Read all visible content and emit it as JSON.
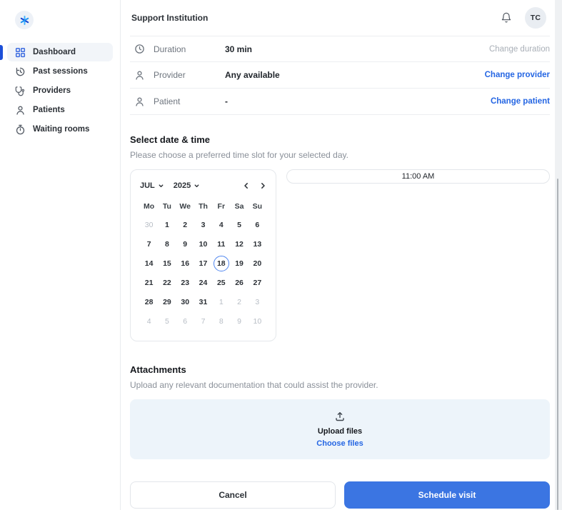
{
  "colors": {
    "accent": "#3b75e2",
    "link": "#2566e3",
    "selected_day_ring": "#4f86f0",
    "active_nav_bar": "#1c4fd8",
    "upload_box_bg": "#edf4fa"
  },
  "sidebar": {
    "logo_icon": "asterisk-logo-icon",
    "items": [
      {
        "label": "Dashboard",
        "icon": "dashboard-grid-icon",
        "active": true
      },
      {
        "label": "Past sessions",
        "icon": "history-clock-icon",
        "active": false
      },
      {
        "label": "Providers",
        "icon": "stethoscope-icon",
        "active": false
      },
      {
        "label": "Patients",
        "icon": "person-icon",
        "active": false
      },
      {
        "label": "Waiting rooms",
        "icon": "stopwatch-icon",
        "active": false
      }
    ]
  },
  "header": {
    "title": "Support Institution",
    "bell_icon": "bell-icon",
    "avatar_initials": "TC"
  },
  "visit_details": {
    "rows": [
      {
        "icon": "clock-icon",
        "label": "Duration",
        "value": "30 min",
        "action": "Change duration",
        "action_enabled": false
      },
      {
        "icon": "person-icon",
        "label": "Provider",
        "value": "Any available",
        "action": "Change provider",
        "action_enabled": true
      },
      {
        "icon": "person-icon",
        "label": "Patient",
        "value": "-",
        "action": "Change patient",
        "action_enabled": true
      }
    ]
  },
  "datetime_section": {
    "title": "Select date & time",
    "subtitle": "Please choose a preferred time slot for your selected day.",
    "calendar": {
      "month_label": "JUL",
      "year_label": "2025",
      "day_names": [
        "Mo",
        "Tu",
        "We",
        "Th",
        "Fr",
        "Sa",
        "Su"
      ],
      "selected_day": 18,
      "days": [
        {
          "day": 30,
          "muted": true
        },
        {
          "day": 1
        },
        {
          "day": 2
        },
        {
          "day": 3
        },
        {
          "day": 4
        },
        {
          "day": 5
        },
        {
          "day": 6
        },
        {
          "day": 7
        },
        {
          "day": 8
        },
        {
          "day": 9
        },
        {
          "day": 10
        },
        {
          "day": 11
        },
        {
          "day": 12
        },
        {
          "day": 13
        },
        {
          "day": 14
        },
        {
          "day": 15
        },
        {
          "day": 16
        },
        {
          "day": 17
        },
        {
          "day": 18,
          "selected": true
        },
        {
          "day": 19
        },
        {
          "day": 20
        },
        {
          "day": 21
        },
        {
          "day": 22
        },
        {
          "day": 23
        },
        {
          "day": 24
        },
        {
          "day": 25
        },
        {
          "day": 26
        },
        {
          "day": 27
        },
        {
          "day": 28
        },
        {
          "day": 29
        },
        {
          "day": 30
        },
        {
          "day": 31
        },
        {
          "day": 1,
          "muted": true
        },
        {
          "day": 2,
          "muted": true
        },
        {
          "day": 3,
          "muted": true
        },
        {
          "day": 4,
          "muted": true
        },
        {
          "day": 5,
          "muted": true
        },
        {
          "day": 6,
          "muted": true
        },
        {
          "day": 7,
          "muted": true
        },
        {
          "day": 8,
          "muted": true
        },
        {
          "day": 9,
          "muted": true
        },
        {
          "day": 10,
          "muted": true
        }
      ]
    },
    "time_slots": [
      "11:00 AM"
    ]
  },
  "attachments": {
    "title": "Attachments",
    "subtitle": "Upload any relevant documentation that could assist the provider.",
    "upload_icon": "upload-icon",
    "upload_label": "Upload files",
    "choose_label": "Choose files"
  },
  "footer": {
    "cancel_label": "Cancel",
    "submit_label": "Schedule visit"
  }
}
